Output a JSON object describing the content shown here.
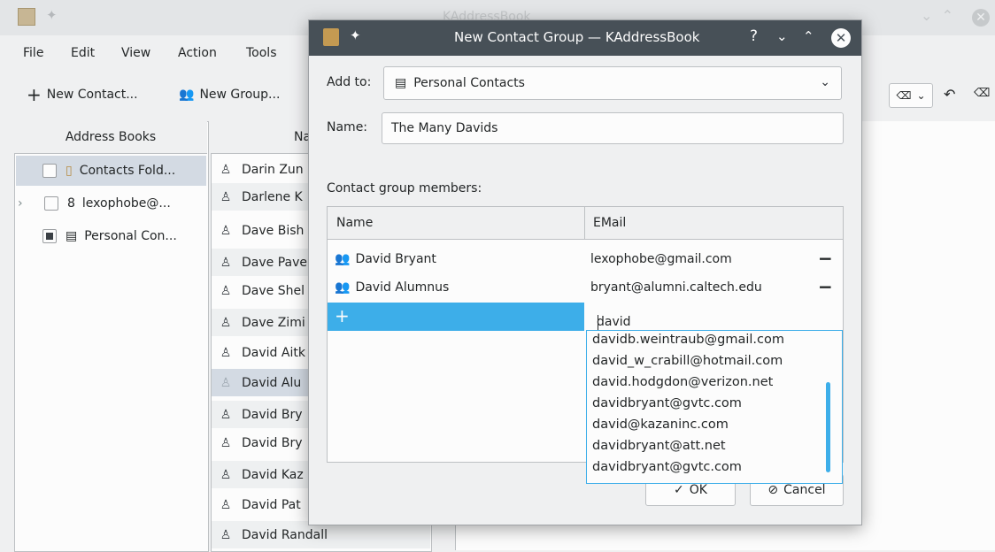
{
  "main_window": {
    "title": "KAddressBook",
    "menu": [
      "File",
      "Edit",
      "View",
      "Action",
      "Tools"
    ],
    "toolbar": {
      "new_contact": "New Contact...",
      "new_group": "New Group..."
    },
    "address_books": {
      "header": "Address Books",
      "items": [
        {
          "label": "Contacts Fold...",
          "icon": "folder-icon"
        },
        {
          "label": "lexophobe@...",
          "icon": "google-icon"
        },
        {
          "label": "Personal Con...",
          "icon": "addressbook-icon"
        }
      ]
    },
    "contacts_list": {
      "header": "Na",
      "rows": [
        "Darin Zun",
        "Darlene K",
        "Dave Bish",
        "Dave Pave",
        "Dave Shel",
        "Dave Zimi",
        "David Aitk",
        "David Alu",
        "David Bry",
        "David Bry",
        "David Kaz",
        "David Pat",
        "David Randall"
      ]
    }
  },
  "dialog": {
    "title": "New Contact Group — KAddressBook",
    "add_to_label": "Add to:",
    "add_to_value": "Personal Contacts",
    "name_label": "Name:",
    "name_value": "The Many Davids",
    "members_label": "Contact group members:",
    "columns": {
      "name": "Name",
      "email": "EMail"
    },
    "members": [
      {
        "name": "David Bryant",
        "email": "lexophobe@gmail.com"
      },
      {
        "name": "David Alumnus",
        "email": "bryant@alumni.caltech.edu"
      }
    ],
    "new_row_email": "david",
    "completions": [
      "davidb.weintraub@gmail.com",
      "david_w_crabill@hotmail.com",
      "david.hodgdon@verizon.net",
      "davidbryant@gvtc.com",
      "david@kazaninc.com",
      "davidbryant@att.net",
      "davidbryant@gvtc.com"
    ],
    "ok_label": "OK",
    "cancel_label": "Cancel"
  },
  "colors": {
    "accent": "#3daee9",
    "titlebar": "#475057",
    "selection": "#d3dae3"
  }
}
